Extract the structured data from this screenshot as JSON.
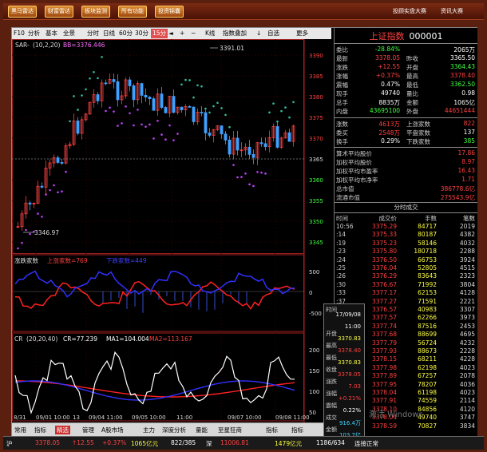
{
  "topbar": {
    "buttons": [
      "黑马雷达",
      "财富雷达",
      "板块监测",
      "所有功能",
      "投资锦囊"
    ],
    "links": [
      "投顾实盘大赛",
      "资讯大赛"
    ]
  },
  "toolbar": {
    "items": [
      "F10",
      "分析",
      "基本",
      "全景",
      "分时",
      "日线",
      "60分",
      "30分",
      "15分",
      "◄",
      "+",
      "−",
      "K线",
      "指数叠加",
      "↓",
      "自选",
      "更多"
    ],
    "selected": "15分"
  },
  "main_chart": {
    "sar_label": "SAR-",
    "sar_params": "(10,2,20)",
    "bb_label": "BB=3376.446",
    "high_label": "3391.01",
    "low_label": "3346.97",
    "y_ticks": [
      "3390",
      "3385",
      "3380",
      "3375",
      "3370",
      "3365",
      "3360",
      "3355",
      "3350",
      "3345"
    ]
  },
  "panel2": {
    "title": "涨跌家数",
    "up_label": "上涨家数=769",
    "down_label": "下跌家数=449",
    "y_ticks": [
      "500",
      "0",
      "-500"
    ]
  },
  "panel3": {
    "title": "CR",
    "params": "(20,20,40)",
    "cr_label": "CR=77.239",
    "ma1_label": "MA1=104.004",
    "ma2_label": "MA2=113.167",
    "y_ticks": [
      "200",
      "150",
      "100",
      "50"
    ]
  },
  "x_axis": {
    "labels": [
      "8/31",
      "09/01 10:00",
      "13",
      "09/04 11:00",
      "09/05 10:00",
      "11:00",
      "09/07 10:00",
      "09/08 11:00"
    ]
  },
  "bottom_tabs": {
    "items": [
      "常用",
      "指标",
      "精选",
      "管理",
      "A股市场",
      "主力",
      "深度分析",
      "量能",
      "至星狂商",
      "指标",
      "指标"
    ],
    "selected": "精选"
  },
  "quote": {
    "name": "上证指数",
    "code": "000001",
    "rows": [
      {
        "l1": "委比",
        "v1": "-28.84%",
        "c1": "grn",
        "l2": "",
        "v2": "2065万",
        "c2": "wht"
      },
      {
        "l1": "最新",
        "v1": "3378.05",
        "c1": "red",
        "l2": "昨收",
        "v2": "3365.50",
        "c2": "wht"
      },
      {
        "l1": "涨跌",
        "v1": "+12.55",
        "c1": "red",
        "l2": "开盘",
        "v2": "3364.43",
        "c2": "grn"
      },
      {
        "l1": "涨幅",
        "v1": "+0.37%",
        "c1": "red",
        "l2": "最高",
        "v2": "3378.40",
        "c2": "red"
      },
      {
        "l1": "震幅",
        "v1": "0.47%",
        "c1": "wht",
        "l2": "最低",
        "v2": "3362.50",
        "c2": "grn"
      },
      {
        "l1": "现手",
        "v1": "49740",
        "c1": "wht",
        "l2": "量比",
        "v2": "0.98",
        "c2": "wht"
      },
      {
        "l1": "总手",
        "v1": "8835万",
        "c1": "wht",
        "l2": "金额",
        "v2": "1065亿",
        "c2": "wht"
      },
      {
        "l1": "内盘",
        "v1": "43695100",
        "c1": "grn",
        "l2": "外盘",
        "v2": "44651444",
        "c2": "red"
      }
    ],
    "rows2": [
      {
        "l1": "涨数",
        "v1": "4613万",
        "c1": "red",
        "l2": "上涨家数",
        "v2": "822",
        "c2": "red"
      },
      {
        "l1": "委买",
        "v1": "2548万",
        "c1": "red",
        "l2": "平盘家数",
        "v2": "137",
        "c2": "wht"
      },
      {
        "l1": "换手",
        "v1": "0.29%",
        "c1": "wht",
        "l2": "下跌家数",
        "v2": "385",
        "c2": "grn"
      }
    ],
    "rows3": [
      {
        "l": "算术平均股价",
        "v": "17.86"
      },
      {
        "l": "加权平均股价",
        "v": "8.97"
      },
      {
        "l": "加权平均市盈率",
        "v": "16.43"
      },
      {
        "l": "加权平均市净率",
        "v": "1.71"
      },
      {
        "l": "总市值",
        "v": "386778.6亿"
      },
      {
        "l": "流通市值",
        "v": "275543.9亿"
      }
    ]
  },
  "tick_list": {
    "title": "分时成交",
    "headers": [
      "时间",
      "成交价",
      "手数",
      "笔数"
    ],
    "rows": [
      [
        "10:56",
        "3375.29",
        "84717",
        "2019"
      ],
      [
        ":14",
        "3375.33",
        "80187",
        "4382"
      ],
      [
        ":19",
        "3375.23",
        "58146",
        "4032"
      ],
      [
        ":23",
        "3375.80",
        "180718",
        "2288"
      ],
      [
        ":24",
        "3376.50",
        "66753",
        "3924"
      ],
      [
        ":25",
        "3376.04",
        "52805",
        "4515"
      ],
      [
        ":26",
        "3376.29",
        "83643",
        "2323"
      ],
      [
        ":30",
        "3376.67",
        "71992",
        "3804"
      ],
      [
        ":33",
        "3377.17",
        "62153",
        "4128"
      ],
      [
        ":37",
        "3377.27",
        "71591",
        "2221"
      ],
      [
        ":40",
        "3376.57",
        "40983",
        "3307"
      ],
      [
        ":41",
        "3377.57",
        "62266",
        "3973"
      ],
      [
        ":43",
        "3377.74",
        "87516",
        "2453"
      ],
      [
        ":44",
        "3377.68",
        "88699",
        "4695"
      ],
      [
        ":46",
        "3377.79",
        "56724",
        "4232"
      ],
      [
        ":47",
        "3377.93",
        "88673",
        "2228"
      ],
      [
        ":48",
        "3378.15",
        "68211",
        "4228"
      ],
      [
        ":49",
        "3377.98",
        "62198",
        "4023"
      ],
      [
        ":50",
        "3377.89",
        "67257",
        "2078"
      ],
      [
        ":51",
        "3377.95",
        "78207",
        "4036"
      ],
      [
        ":52",
        "3378.04",
        "61198",
        "4023"
      ],
      [
        ":53",
        "3377.91",
        "74559",
        "2114"
      ],
      [
        ":54",
        "3378.10",
        "84856",
        "4120"
      ],
      [
        ":55",
        "3378.04",
        "49740",
        "3747"
      ],
      [
        ":56",
        "3378.59",
        "70827",
        "3834"
      ]
    ]
  },
  "tooltip": {
    "rows": [
      {
        "l": "时间",
        "v": "17/09/08"
      },
      {
        "l": "",
        "v": "11:00"
      },
      {
        "l": "开盘",
        "v": "3370.83",
        "c": "yel"
      },
      {
        "l": "最高",
        "v": "3378.40",
        "c": "red"
      },
      {
        "l": "最低",
        "v": "3370.83",
        "c": "yel"
      },
      {
        "l": "收盘",
        "v": "3378.05",
        "c": "red"
      },
      {
        "l": "涨跌",
        "v": "7.03",
        "c": "red"
      },
      {
        "l": "涨幅",
        "v": "+0.21%",
        "c": "red"
      },
      {
        "l": "震幅",
        "v": "0.22%",
        "c": "wht"
      },
      {
        "l": "成交",
        "v": "916.4万",
        "c": "cyan"
      },
      {
        "l": "金额",
        "v": "103.7亿",
        "c": "cyan"
      }
    ]
  },
  "status": {
    "items": [
      {
        "t": "沪",
        "c": "wht"
      },
      {
        "t": "3378.05",
        "c": "red"
      },
      {
        "t": "↑12.55",
        "c": "red"
      },
      {
        "t": "+0.37%",
        "c": "red"
      },
      {
        "t": "1065亿元",
        "c": "yel"
      },
      {
        "t": "822/385",
        "c": "wht"
      },
      {
        "t": "深",
        "c": "wht"
      },
      {
        "t": "11006.81",
        "c": "red"
      },
      {
        "t": "1479亿元",
        "c": "yel"
      },
      {
        "t": "1186/634",
        "c": "wht"
      },
      {
        "t": "连接正常",
        "c": "wht"
      }
    ]
  },
  "watermark": "激活 Windows"
}
